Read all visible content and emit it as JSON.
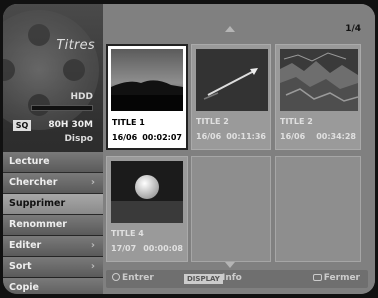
{
  "left_panel": {
    "title": "Titres",
    "storage_label": "HDD",
    "mode_badge": "SQ",
    "remaining": "80H 30M",
    "available_label": "Dispo"
  },
  "menu": {
    "items": [
      {
        "label": "Lecture"
      },
      {
        "label": "Chercher"
      },
      {
        "label": "Supprimer"
      },
      {
        "label": "Renommer"
      },
      {
        "label": "Editer"
      },
      {
        "label": "Sort"
      },
      {
        "label": "Copie"
      }
    ]
  },
  "grid": {
    "page": "1/4",
    "titles": [
      {
        "name": "TITLE 1",
        "date": "16/06",
        "duration": "00:02:07"
      },
      {
        "name": "TITLE 2",
        "date": "16/06",
        "duration": "00:11:36"
      },
      {
        "name": "TITLE 2",
        "date": "16/06",
        "duration": "00:34:28"
      },
      {
        "name": "TITLE 4",
        "date": "17/07",
        "duration": "00:00:08"
      }
    ]
  },
  "footer": {
    "enter_label": "Entrer",
    "display_key": "DISPLAY",
    "info_label": "Info",
    "close_label": "Fermer"
  },
  "icons": [
    "film-reel-icon",
    "arrow-up-icon",
    "arrow-down-icon",
    "enter-icon",
    "close-icon",
    "chevron-right-icon"
  ]
}
